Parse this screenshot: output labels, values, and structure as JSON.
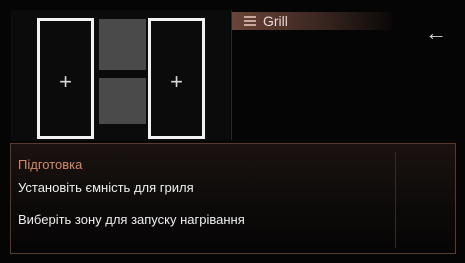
{
  "zones": {
    "left_plus": "+",
    "right_plus": "+"
  },
  "program": {
    "icon": "grill-icon",
    "name": "Grill"
  },
  "navigation": {
    "back_arrow": "←"
  },
  "info": {
    "title": "Підготовка",
    "line1": "Установіть ємність для гриля",
    "line2": "Виберіть зону для запуску нагрівання"
  },
  "colors": {
    "accent": "#d38a6a",
    "zone_border": "#f2f2f2",
    "bridge": "#4a4a4a",
    "background": "#050505"
  }
}
